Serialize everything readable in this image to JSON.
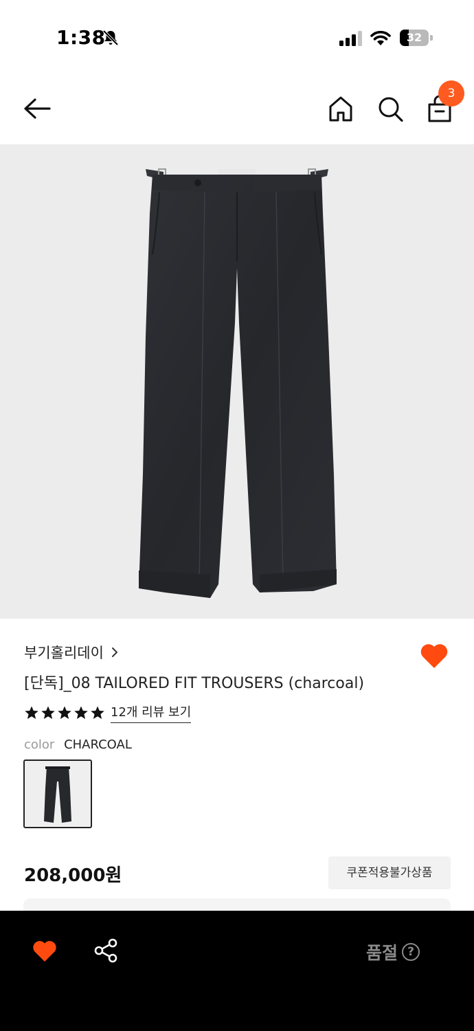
{
  "status_bar": {
    "time": "1:38",
    "battery": "32",
    "battery_level": 0.32,
    "icons": [
      "bell-slash-icon",
      "cellular-signal-icon",
      "wifi-icon",
      "battery-icon"
    ]
  },
  "nav": {
    "icons": [
      "back-arrow-icon",
      "home-icon",
      "search-icon",
      "shopping-bag-icon"
    ],
    "cart_count": "3"
  },
  "product": {
    "image_icon": "charcoal-trousers-image",
    "brand": "부기홀리데이",
    "title": "[단독]_08 TAILORED FIT TROUSERS (charcoal)",
    "rating_stars": 5,
    "review_link": "12개 리뷰 보기",
    "color_label": "color",
    "color_value": "CHARCOAL",
    "price": "208,000원",
    "coupon_badge": "쿠폰적용불가상품"
  },
  "colors": {
    "accent": "#ff5a1f",
    "hero_bg": "#ececec",
    "bottom_bar": "#000000",
    "muted": "#8a8a8a"
  },
  "bottom_bar": {
    "icons": [
      "heart-icon",
      "share-icon",
      "help-circle-icon"
    ],
    "soldout_label": "품절",
    "help_symbol": "?"
  }
}
